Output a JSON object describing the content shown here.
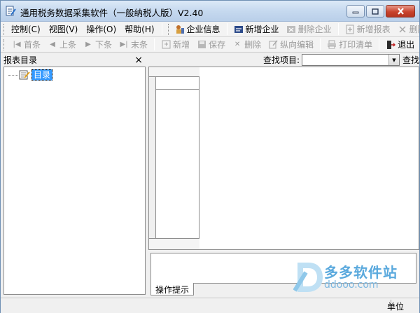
{
  "window": {
    "title": "通用税务数据采集软件（一般纳税人版）V2.40",
    "buttons": {
      "minimize_icon": "minimize-icon",
      "maximize_icon": "maximize-icon",
      "close_icon": "close-icon"
    }
  },
  "menu": {
    "items": [
      "控制(C)",
      "视图(V)",
      "操作(O)",
      "帮助(H)"
    ]
  },
  "toolbar1": {
    "enterprise_info": "企业信息",
    "new_enterprise": "新增企业",
    "delete_enterprise": "删除企业",
    "new_report": "新增报表",
    "delete_report": "删除报"
  },
  "toolbar2": {
    "first": "首条",
    "prev": "上条",
    "next": "下条",
    "last": "末条",
    "add": "新增",
    "save": "保存",
    "delete": "删除",
    "vertical_edit": "纵向编辑",
    "print_list": "打印清单",
    "exit": "退出"
  },
  "left_panel": {
    "title": "报表目录",
    "close": "×",
    "tree_root": "目录"
  },
  "search": {
    "label": "查找项目:",
    "selected": "",
    "button": "查找"
  },
  "hint": {
    "tab_label": "操作提示"
  },
  "status": {
    "right_text": "单位"
  },
  "watermark": {
    "title": "多多软件站",
    "url": "ddooo.com"
  },
  "colors": {
    "selection": "#3399ff",
    "title_gradient_top": "#dce9f7",
    "close_button": "#c9442d"
  }
}
